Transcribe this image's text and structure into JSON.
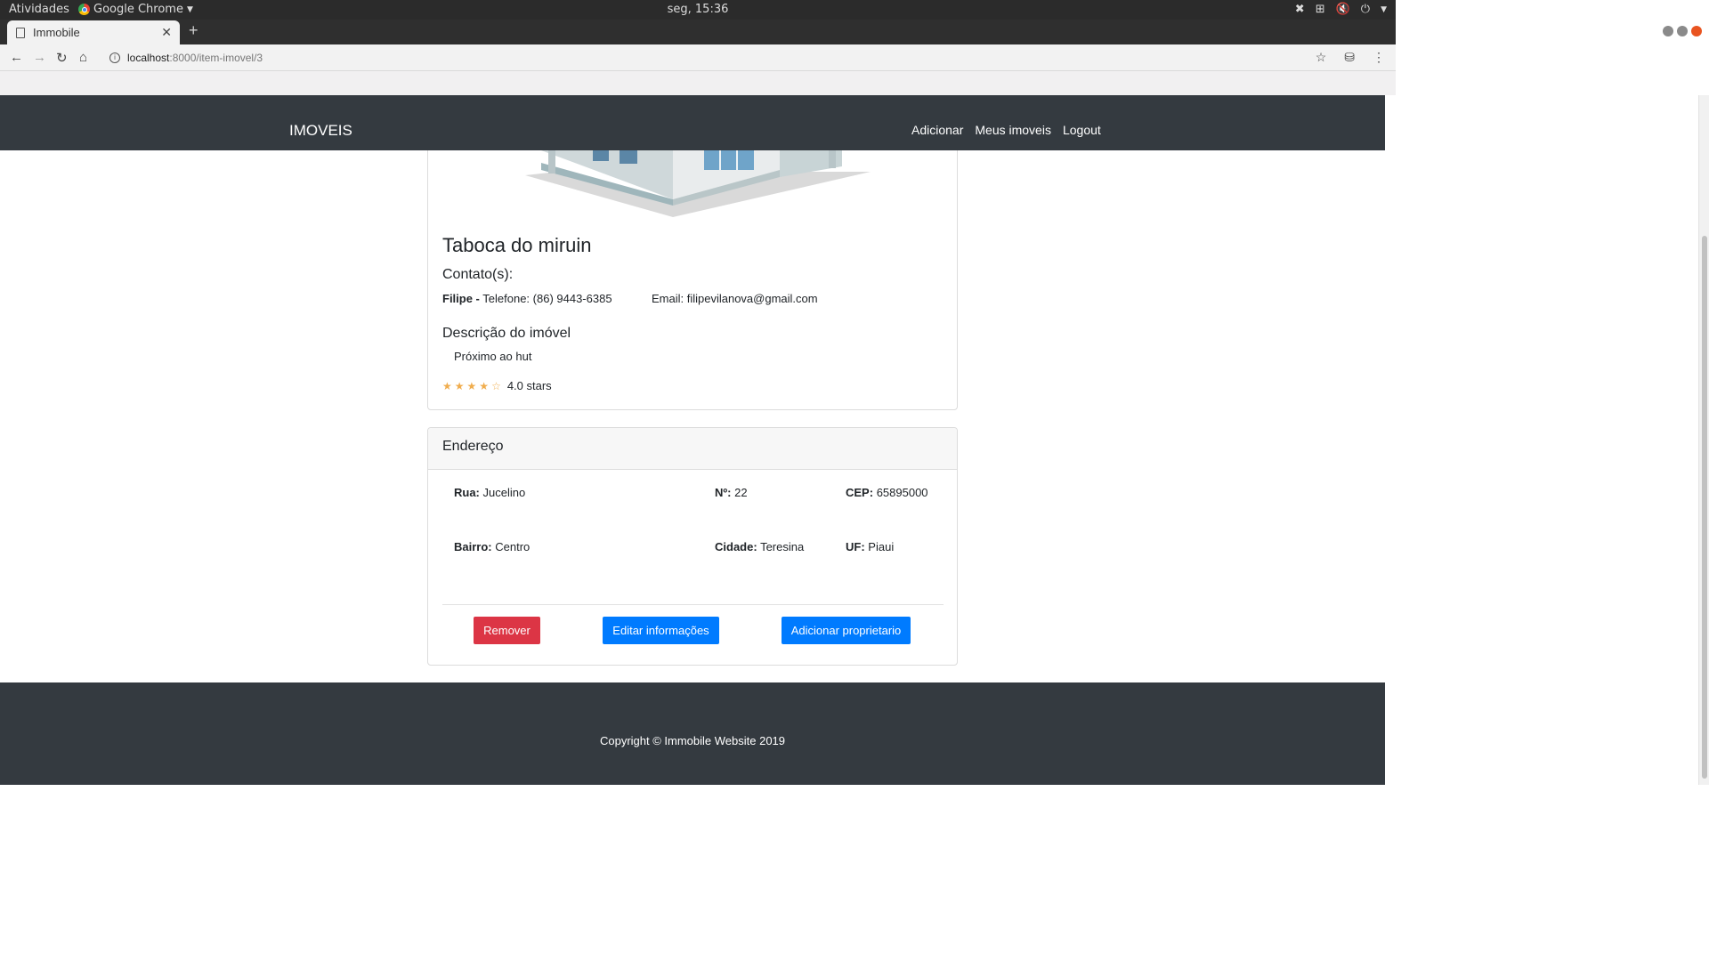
{
  "os": {
    "activities": "Atividades",
    "app_name": "Google Chrome",
    "clock": "seg, 15:36"
  },
  "browser": {
    "tab_title": "Immobile",
    "url_host": "localhost",
    "url_rest": ":8000/item-imovel/3"
  },
  "navbar": {
    "brand": "IMOVEIS",
    "links": [
      "Adicionar",
      "Meus imoveis",
      "Logout"
    ]
  },
  "property": {
    "title": "Taboca do miruin",
    "contacts_heading": "Contato(s):",
    "contact_name": "Filipe -",
    "contact_phone": "Telefone: (86) 9443-6385",
    "contact_email": "Email: filipevilanova@gmail.com",
    "description_heading": "Descrição do imóvel",
    "description": "Próximo ao hut",
    "rating": 4.0,
    "rating_max": 5,
    "rating_text": "4.0 stars"
  },
  "address": {
    "heading": "Endereço",
    "rua_label": "Rua:",
    "rua": "Jucelino",
    "numero_label": "Nº:",
    "numero": "22",
    "cep_label": "CEP:",
    "cep": "65895000",
    "bairro_label": "Bairro:",
    "bairro": "Centro",
    "cidade_label": "Cidade:",
    "cidade": "Teresina",
    "uf_label": "UF:",
    "uf": "Piaui"
  },
  "actions": {
    "remove": "Remover",
    "edit": "Editar informações",
    "add_owner": "Adicionar proprietario"
  },
  "footer": {
    "copyright": "Copyright © Immobile Website 2019"
  },
  "colors": {
    "navbar_bg": "#343a40",
    "danger": "#dc3545",
    "primary": "#007bff",
    "star": "#f0ad4e"
  }
}
